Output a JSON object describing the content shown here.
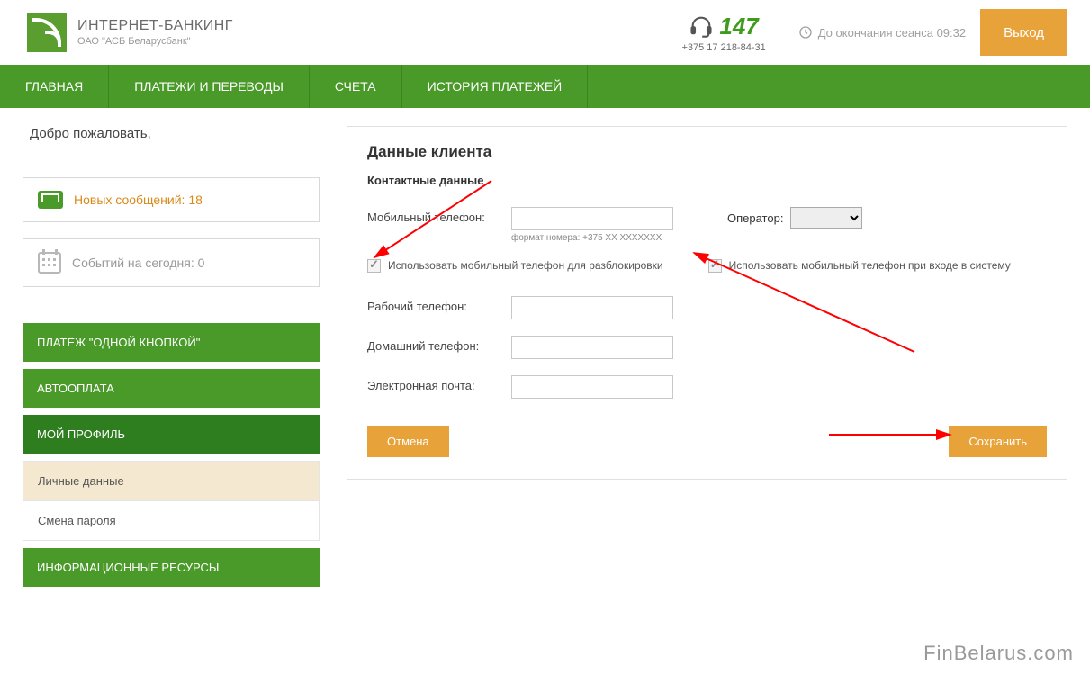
{
  "header": {
    "title": "ИНТЕРНЕТ-БАНКИНГ",
    "subtitle": "ОАО \"АСБ Беларусбанк\"",
    "support_number": "147",
    "support_phone": "+375 17 218-84-31",
    "session_end": "До окончания сеанса 09:32",
    "logout": "Выход"
  },
  "nav": {
    "items": [
      "ГЛАВНАЯ",
      "ПЛАТЕЖИ И ПЕРЕВОДЫ",
      "СЧЕТА",
      "ИСТОРИЯ ПЛАТЕЖЕЙ"
    ]
  },
  "sidebar": {
    "welcome": "Добро пожаловать,",
    "messages_label": "Новых сообщений: ",
    "messages_count": "18",
    "events_label": "Событий на сегодня: ",
    "events_count": "0",
    "menu": {
      "one_click": "ПЛАТЁЖ \"ОДНОЙ КНОПКОЙ\"",
      "autopay": "АВТООПЛАТА",
      "profile": "МОЙ ПРОФИЛЬ",
      "profile_items": [
        "Личные данные",
        "Смена пароля"
      ],
      "info_res": "ИНФОРМАЦИОННЫЕ РЕСУРСЫ"
    }
  },
  "panel": {
    "title": "Данные клиента",
    "subtitle": "Контактные данные",
    "mobile_label": "Мобильный телефон:",
    "format_hint": "формат номера: +375 XX XXXXXXX",
    "operator_label": "Оператор:",
    "check_unlock": "Использовать мобильный телефон для разблокировки",
    "check_login": "Использовать мобильный телефон при входе в систему",
    "work_label": "Рабочий телефон:",
    "home_label": "Домашний телефон:",
    "email_label": "Электронная почта:",
    "cancel": "Отмена",
    "save": "Сохранить"
  },
  "watermark": "FinBelarus.com"
}
